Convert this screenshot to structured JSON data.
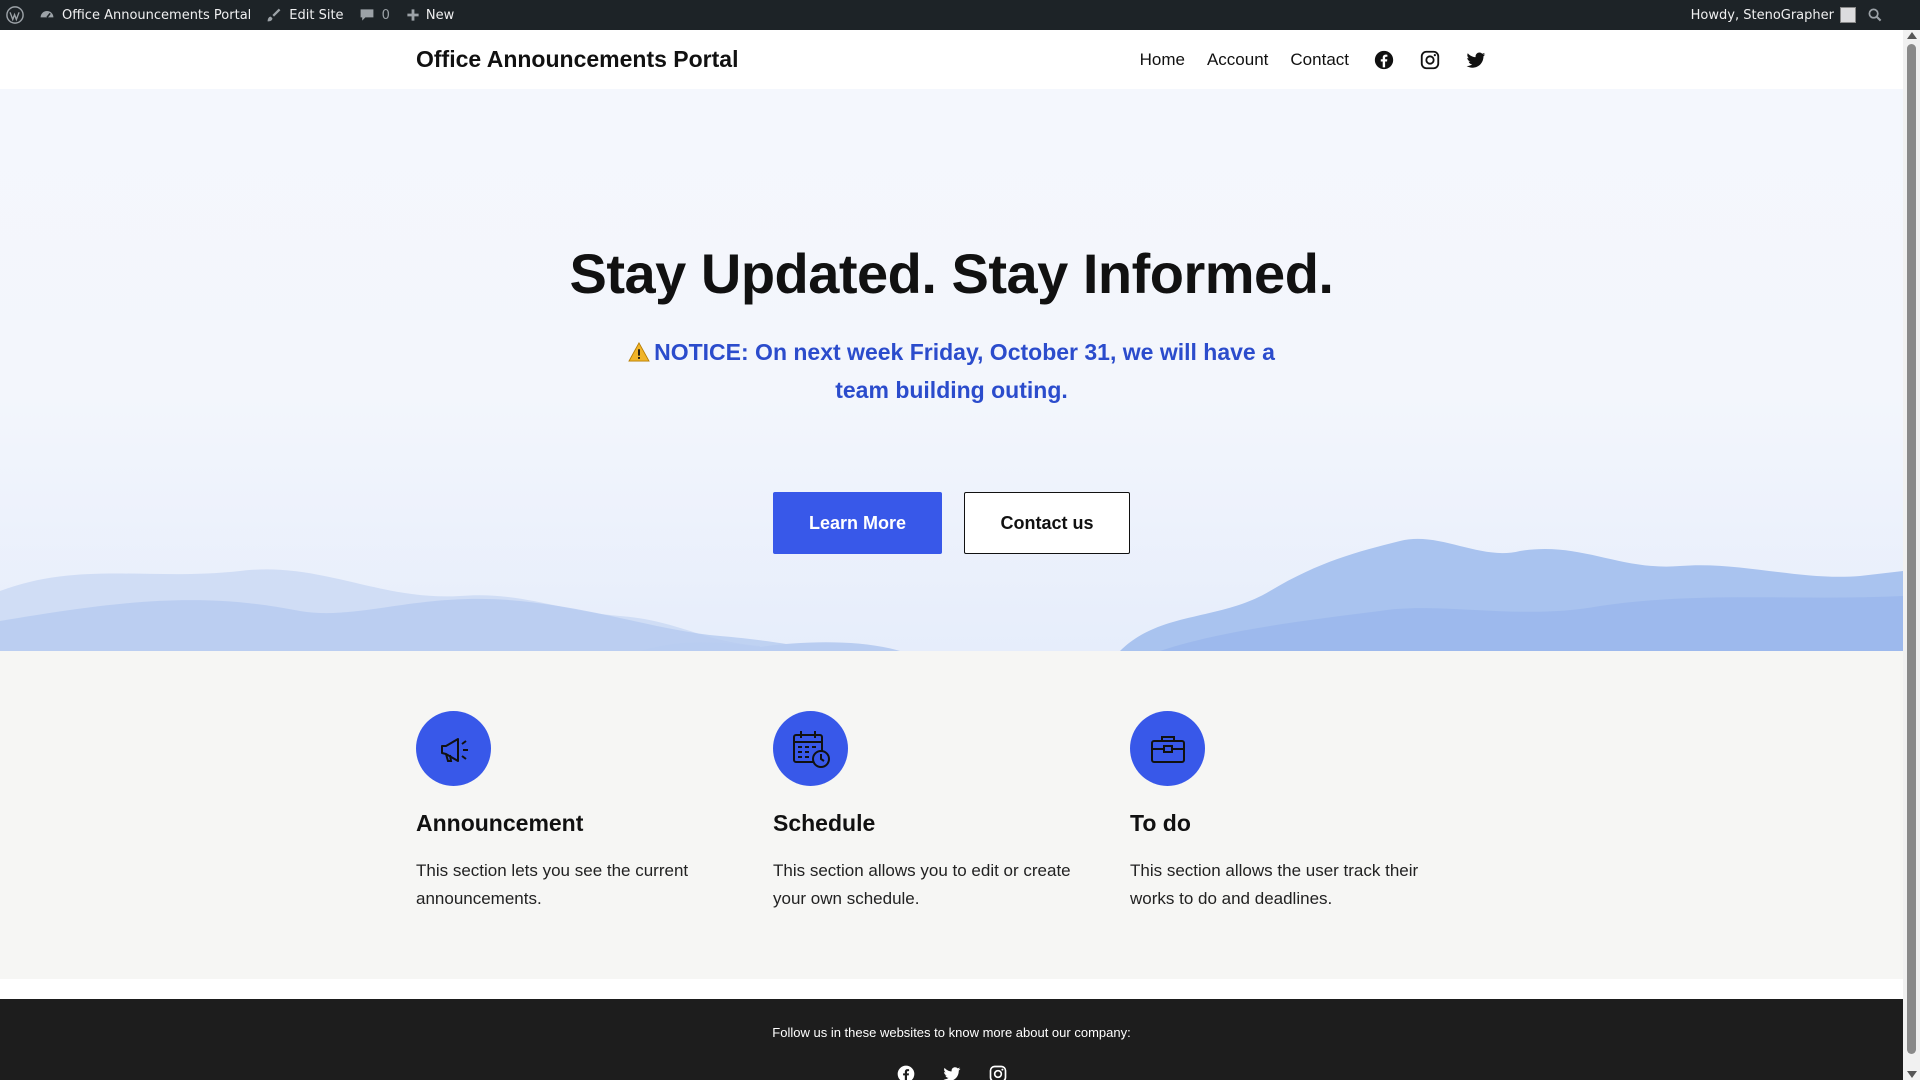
{
  "admin_bar": {
    "site_name": "Office Announcements Portal",
    "edit_site": "Edit Site",
    "comments_count": "0",
    "new_label": "New",
    "greeting": "Howdy, StenoGrapher"
  },
  "header": {
    "site_title": "Office Announcements Portal",
    "nav": [
      "Home",
      "Account",
      "Contact"
    ],
    "social_icons": [
      "facebook-icon",
      "instagram-icon",
      "twitter-icon"
    ]
  },
  "hero": {
    "headline": "Stay Updated. Stay Informed.",
    "notice_icon": "warning-icon",
    "notice_text": "NOTICE: On next week Friday, October 31, we will have a team building outing.",
    "primary_button": "Learn More",
    "secondary_button": "Contact us"
  },
  "features": [
    {
      "icon": "megaphone-icon",
      "title": "Announcement",
      "text": "This section lets you see the current announcements."
    },
    {
      "icon": "calendar-clock-icon",
      "title": "Schedule",
      "text": "This section allows you to edit or create your own schedule."
    },
    {
      "icon": "briefcase-icon",
      "title": "To do",
      "text": "This section allows the user track their works to do and deadlines."
    }
  ],
  "footer": {
    "text": "Follow us in these websites to know more about our company:",
    "social_icons": [
      "facebook-icon",
      "twitter-icon",
      "instagram-icon"
    ]
  },
  "colors": {
    "accent": "#3858e9",
    "notice": "#2b4ccc",
    "admin_bar": "#1d2327",
    "footer": "#1d1d1d",
    "features_bg": "#f6f6f4"
  }
}
